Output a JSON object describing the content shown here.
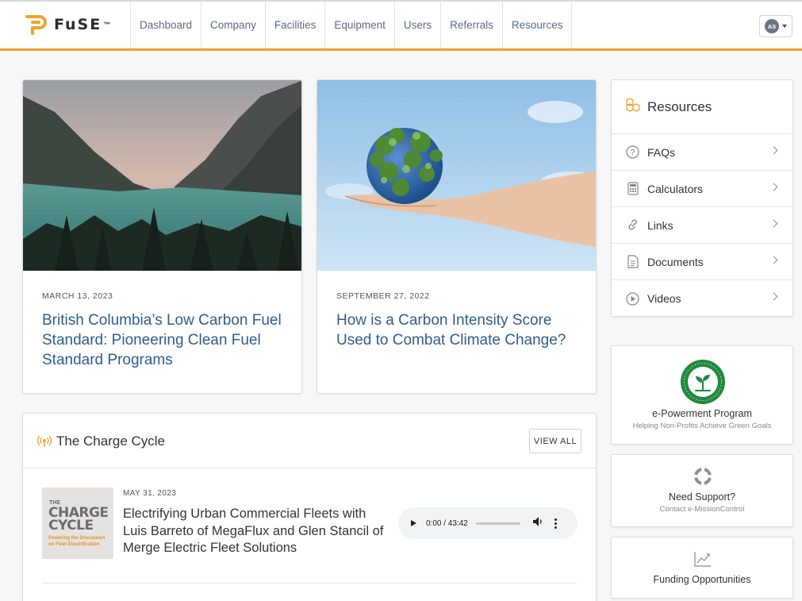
{
  "header": {
    "logo_text": "FuSE",
    "logo_tm": "™",
    "nav": [
      "Dashboard",
      "Company",
      "Facilities",
      "Equipment",
      "Users",
      "Referrals",
      "Resources"
    ],
    "user_initials": "AS"
  },
  "articles": [
    {
      "date": "MARCH 13, 2023",
      "title": "British Columbia’s Low Carbon Fuel Standard: Pioneering Clean Fuel Standard Programs"
    },
    {
      "date": "SEPTEMBER 27, 2022",
      "title": "How is a Carbon Intensity Score Used to Combat Climate Change?"
    }
  ],
  "resources": {
    "title": "Resources",
    "items": [
      "FAQs",
      "Calculators",
      "Links",
      "Documents",
      "Videos"
    ]
  },
  "epowerment": {
    "title": "e-Powerment Program",
    "subtitle": "Helping Non-Profits Achieve Green Goals"
  },
  "support": {
    "title": "Need Support?",
    "subtitle": "Contact e-MissionControl"
  },
  "funding": {
    "title": "Funding Opportunities"
  },
  "charge_cycle": {
    "title": "The Charge Cycle",
    "view_all": "VIEW ALL",
    "episode": {
      "thumb_line1": "THE",
      "thumb_line2": "CHARGE",
      "thumb_line3": "CYCLE",
      "thumb_tagline": "Powering the Discussion on Fleet Electrification",
      "date": "MAY 31, 2023",
      "title": "Electrifying Urban Commercial Fleets with Luis Barreto of MegaFlux and Glen Stancil of Merge Electric Fleet Solutions",
      "audio_time": "0:00 / 43:42"
    }
  },
  "colors": {
    "accent": "#f0a32a",
    "link": "#2f5d8a",
    "nav_text": "#5a6b85",
    "badge_green": "#1f8a3c"
  }
}
